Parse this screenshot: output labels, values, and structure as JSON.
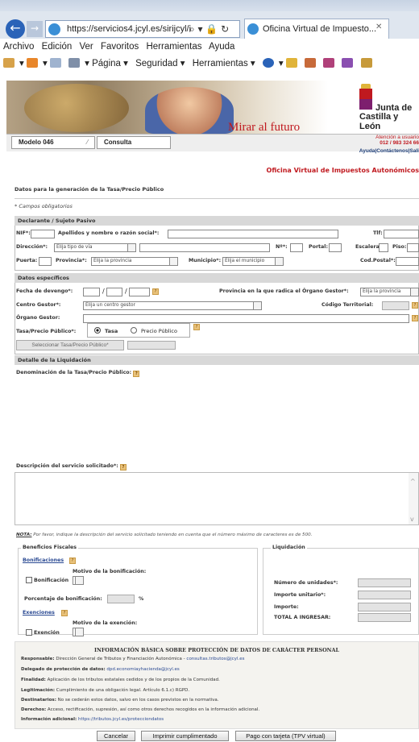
{
  "browser": {
    "url": "https://servicios4.jcyl.es/sirijcyl/i",
    "tab_title": "Oficina Virtual de Impuesto...",
    "menu": [
      "Archivo",
      "Edición",
      "Ver",
      "Favoritos",
      "Herramientas",
      "Ayuda"
    ],
    "commands": [
      "Página ▾",
      "Seguridad ▾",
      "Herramientas ▾"
    ]
  },
  "banner": {
    "slogan": "Mirar al futuro",
    "brand_line1": "Junta de",
    "brand_line2": "Castilla y León"
  },
  "header": {
    "modelo": "Modelo 046",
    "consulta": "Consulta",
    "atencion_line1": "Atención a usuario",
    "atencion_line2": "012 / 983 324 66",
    "links": "Ayuda|Contáctenos|Sali",
    "oficina": "Oficina Virtual de Impuestos Autonómicos"
  },
  "form": {
    "title": "Datos para la generación de la Tasa/Precio Público",
    "obligatorios": "* Campos obligatorios",
    "declarante": {
      "heading": "Declarante / Sujeto Pasivo",
      "nif": "NIF*:",
      "apellidos": "Apellidos y nombre o razón social*:",
      "tlf": "Tlf:",
      "direccion": "Dirección*:",
      "via_select": "Elija tipo de vía",
      "num": "Nº*:",
      "portal": "Portal:",
      "escalera": "Escalera:",
      "piso": "Piso:",
      "puerta": "Puerta:",
      "provincia": "Provincia*:",
      "provincia_select": "Elija la provincia",
      "municipio": "Municipio*:",
      "municipio_select": "Elija el municipio",
      "cod_postal": "Cod.Postal*:"
    },
    "especificos": {
      "heading": "Datos específicos",
      "fecha": "Fecha de devengo*:",
      "provincia_organo": "Provincia en la que radica el Órgano Gestor*:",
      "provincia_organo_select": "Elija la provincia",
      "centro": "Centro Gestor*:",
      "centro_select": "Elija un centro gestor",
      "codigo_territorial": "Código Territorial:",
      "organo": "Órgano Gestor:",
      "tasa_precio": "Tasa/Precio Público*:",
      "opt_tasa": "Tasa",
      "opt_precio": "Precio Público",
      "seleccionar_btn": "Seleccionar Tasa/Precio Público*"
    },
    "liquidacion_detalle": {
      "heading": "Detalle de la Liquidación",
      "denominacion": "Denominación de la Tasa/Precio Público:",
      "descripcion": "Descripción del servicio solicitado*:",
      "nota_label": "NOTA:",
      "nota_text": " Por favor, indique la descripción del servicio solicitado teniendo en cuenta que el número máximo de caracteres es de 500."
    },
    "beneficios": {
      "legend": "Beneficios Fiscales",
      "bonificaciones": "Bonificaciones",
      "motivo_bonif": "Motivo de la bonificación:",
      "bonificacion": "Bonificación",
      "porcentaje": "Porcentaje de bonificación:",
      "pct": "%",
      "exenciones": "Exenciones",
      "motivo_exen": "Motivo de la exención:",
      "exencion": "Exención"
    },
    "liquidacion": {
      "legend": "Liquidación",
      "unidades": "Número de unidades*:",
      "importe_unitario": "Importe unitario*:",
      "importe": "Importe:",
      "total": "TOTAL A INGRESAR:"
    }
  },
  "privacy": {
    "title": "INFORMACIÓN BÁSICA SOBRE PROTECCIÓN DE DATOS DE CARÁCTER PERSONAL",
    "responsable_label": "Responsable:",
    "responsable_text": " Dirección General de Tributos y Financiación Autonómica - ",
    "responsable_link": "consultas.tributos@jcyl.es",
    "delegado_label": "Delegado de protección de datos:",
    "delegado_link": " dpd.economiayhacienda@jcyl.es",
    "finalidad_label": "Finalidad:",
    "finalidad_text": " Aplicación de los tributos estatales cedidos y de los propios de la Comunidad.",
    "legitimacion_label": "Legitimación:",
    "legitimacion_text": " Cumplimiento de una obligación legal. Artículo 6.1.c) RGPD.",
    "destinatarios_label": "Destinatarios:",
    "destinatarios_text": " No se cederán estos datos, salvo en los casos previstos en la normativa.",
    "derechos_label": "Derechos:",
    "derechos_text": " Acceso, rectificación, supresión, así como otros derechos recogidos en la información adicional.",
    "adicional_label": "Información adicional:",
    "adicional_link": " https://tributos.jcyl.es/protecciondatos"
  },
  "actions": {
    "cancelar": "Cancelar",
    "imprimir": "Imprimir cumplimentado",
    "pago": "Pago con tarjeta (TPV virtual)"
  },
  "colors": {
    "accent_red": "#c0191f",
    "link_blue": "#2b4a93",
    "section_gray": "#d8d8d8"
  }
}
